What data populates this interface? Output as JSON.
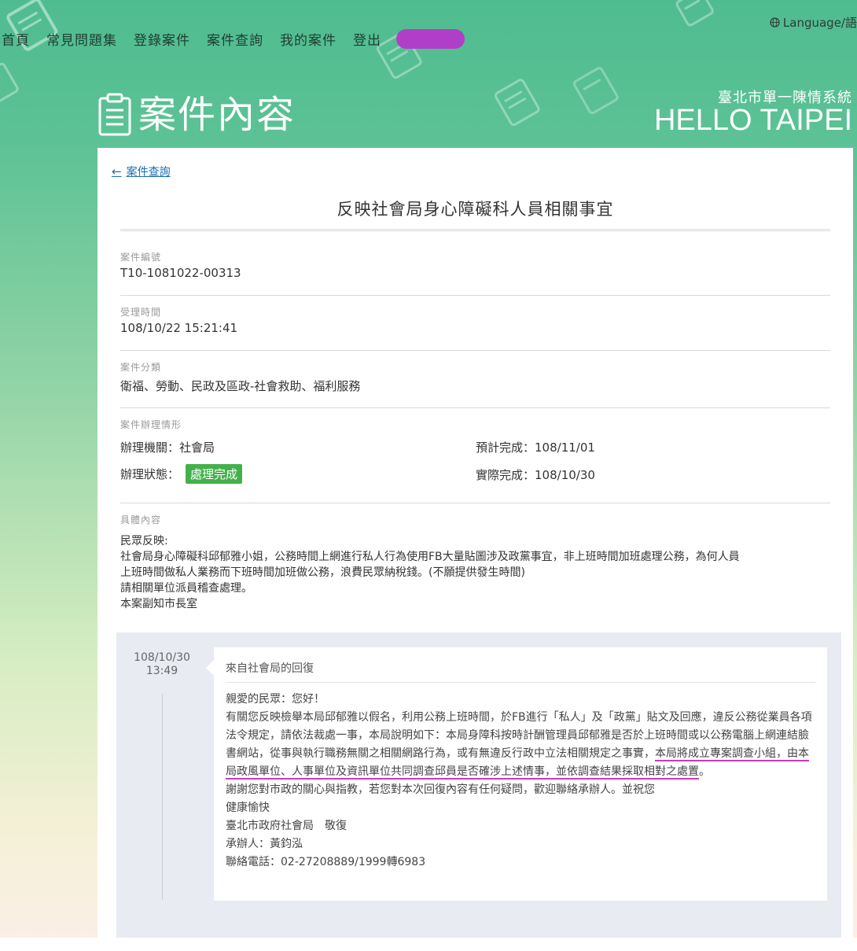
{
  "nav": {
    "items": [
      "首頁",
      "常見問題集",
      "登錄案件",
      "案件查詢",
      "我的案件",
      "登出"
    ],
    "language": "Language/語"
  },
  "header": {
    "title": "案件內容",
    "brand_sub": "臺北市單一陳情系統",
    "brand": "HELLO TAIPEI"
  },
  "case": {
    "back_label": "案件查詢",
    "title": "反映社會局身心障礙科人員相關事宜",
    "number_label": "案件編號",
    "number": "T10-1081022-00313",
    "received_label": "受理時間",
    "received": "108/10/22 15:21:41",
    "category_label": "案件分類",
    "category": "衛福、勞動、民政及區政-社會救助、福利服務",
    "status_section_label": "案件辦理情形",
    "agency_label": "辦理機關：",
    "agency": "社會局",
    "status_label": "辦理狀態：",
    "status": "處理完成",
    "expected_label": "預計完成：",
    "expected": "108/11/01",
    "actual_label": "實際完成：",
    "actual": "108/10/30",
    "content_label": "具體內容",
    "content_lines": [
      "民眾反映:",
      "社會局身心障礙科邱郁雅小姐，公務時間上網進行私人行為使用FB大量貼圖涉及政黨事宜，非上班時間加班處理公務，為何人員",
      "上班時間做私人業務而下班時間加班做公務，浪費民眾納稅錢。(不願提供發生時間)",
      "請相關單位派員稽查處理。",
      "本案副知市長室"
    ]
  },
  "reply": {
    "date": "108/10/30",
    "time": "13:49",
    "from": "來自社會局的回復",
    "greeting": "親愛的民眾：您好！",
    "p1_a": "有關您反映檢舉本局邱郁雅以假名，利用公務上班時間，於FB進行「私人」及「政黨」貼文及回應，違反公務從業員各項法令規定，請依法裁處一事，本局說明如下：本局身障科按時計酬管理員邱郁雅是否於上班時間或以公務電腦上網連結臉書網站，從事與執行職務無關之相關網路行為，或有無違反行政中立法相關規定之事實，",
    "p1_hl": "本局將成立專案調查小組，由本局政風單位、人事單位及資訊單位共同調查邱員是否確涉上述情事，並依調查結果採取相對之處置",
    "p1_end": "。",
    "thanks": "謝謝您對市政的關心與指教，若您對本次回復內容有任何疑問，歡迎聯絡承辦人。並祝您",
    "wish": "健康愉快",
    "sign": "臺北市政府社會局　敬復",
    "handler": "承辦人：黃鈞泓",
    "phone": "聯絡電話：02-27208889/1999轉6983"
  },
  "colors": {
    "accent_pill": "#b13ec9",
    "status_green": "#43b14b",
    "link_blue": "#1a6fb0",
    "highlight_underline": "#c83ab8"
  }
}
